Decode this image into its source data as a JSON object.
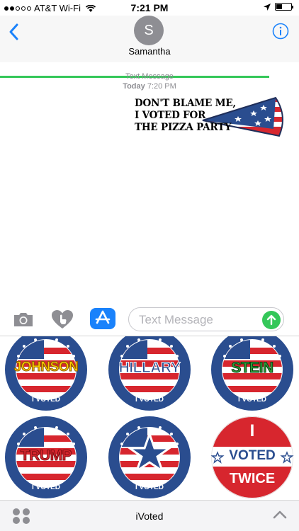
{
  "status_bar": {
    "carrier": "AT&T Wi-Fi",
    "time": "7:21 PM"
  },
  "header": {
    "avatar_initial": "S",
    "contact_name": "Samantha"
  },
  "conversation": {
    "meta_type": "Text Message",
    "meta_day": "Today",
    "meta_time": "7:20 PM",
    "sticker_lines": [
      "DON'T BLAME ME,",
      "I VOTED FOR",
      "THE PIZZA PARTY"
    ]
  },
  "input": {
    "placeholder": "Text Message"
  },
  "stickers": {
    "johnson": "JOHNSON",
    "hillary": "HILLARY",
    "stein": "STEIN",
    "trump": "TRUMP",
    "i_voted": "I VOTED",
    "twice_top": "I",
    "twice_mid": "VOTED",
    "twice_bottom": "TWICE"
  },
  "app_bar": {
    "app_name": "iVoted"
  },
  "colors": {
    "accent": "#1a82fb",
    "send": "#34c759",
    "badge_blue": "#2a4d8f",
    "badge_red": "#d7262e"
  }
}
